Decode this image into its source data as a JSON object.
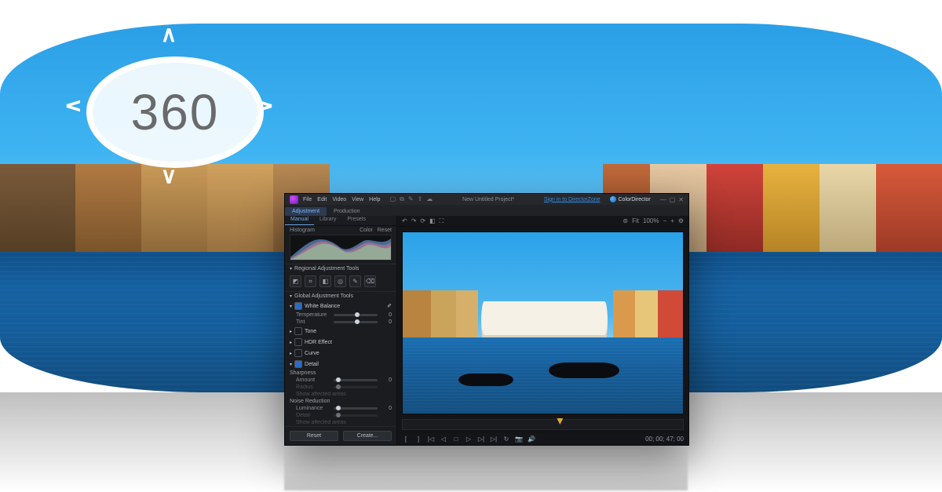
{
  "badge": {
    "label": "360"
  },
  "app": {
    "menu": {
      "file": "File",
      "edit": "Edit",
      "video": "Video",
      "view": "View",
      "help": "Help"
    },
    "project_title": "New Untitled Project*",
    "signin": "Sign in to DirectorZone",
    "brand": "ColorDirector",
    "mode_tabs": {
      "adjustment": "Adjustment",
      "production": "Production"
    },
    "left_tabs": {
      "manual": "Manual",
      "library": "Library",
      "presets": "Presets"
    },
    "histogram": {
      "title": "Histogram",
      "color": "Color",
      "reset": "Reset"
    },
    "regional": {
      "title": "Regional Adjustment Tools",
      "tools": {
        "mask": "mask",
        "crop": "crop",
        "grad": "gradient",
        "radial": "radial",
        "brush": "brush",
        "eraser": "eraser"
      }
    },
    "global": {
      "title": "Global Adjustment Tools"
    },
    "white_balance": {
      "title": "White Balance",
      "temperature": {
        "label": "Temperature",
        "value": "0"
      },
      "tint": {
        "label": "Tint",
        "value": "0"
      }
    },
    "sections": {
      "tone": "Tone",
      "hdr": "HDR Effect",
      "curve": "Curve",
      "detail": "Detail"
    },
    "detail": {
      "sharpness": "Sharpness",
      "amount": {
        "label": "Amount",
        "value": "0"
      },
      "radius": {
        "label": "Radius",
        "value": ""
      },
      "edge_mask": {
        "label": "Show affected areas",
        "value": ""
      },
      "noise_reduction": "Noise Reduction",
      "luminance": {
        "label": "Luminance",
        "value": "0"
      },
      "detail_slider": {
        "label": "Detail",
        "value": ""
      },
      "show_affected": {
        "label": "Show affected areas",
        "value": ""
      }
    },
    "footer": {
      "reset": "Reset",
      "create": "Create..."
    },
    "preview_toolbar": {
      "undo": "↶",
      "redo": "↷",
      "rotate": "⟳",
      "compare": "◧",
      "fullscreen": "⛶",
      "fit": "Fit",
      "p100": "100%",
      "zoom_out": "−",
      "zoom_in": "+",
      "view360": "⊚",
      "settings": "⚙"
    },
    "transport": {
      "goto_start": "|◁",
      "prev": "◁",
      "stop": "□",
      "play": "▷",
      "next": "▷|",
      "goto_end": "▷|",
      "loop": "↻",
      "snapshot": "📷",
      "vol": "🔊",
      "timecode": "00; 00; 47; 00"
    }
  }
}
